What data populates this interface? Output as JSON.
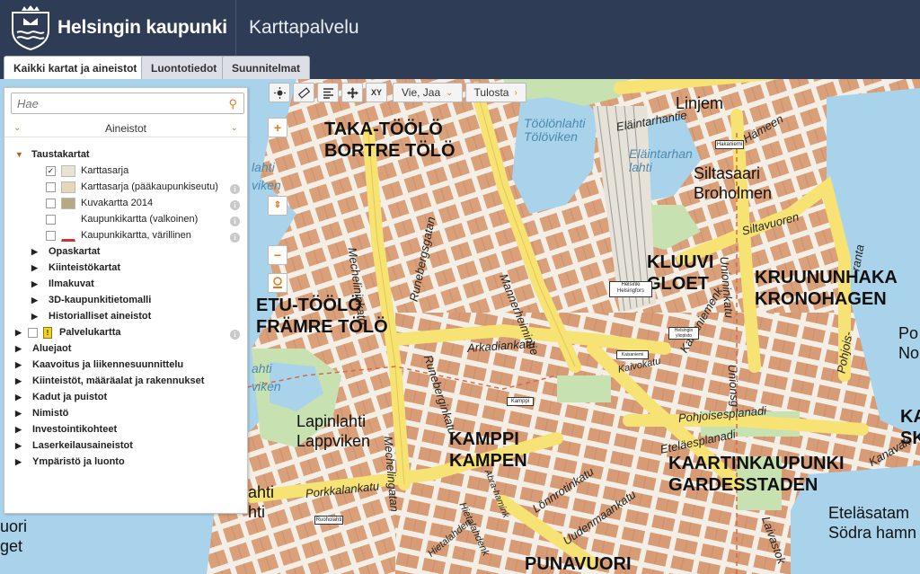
{
  "header": {
    "brand": "Helsingin kaupunki",
    "app_title": "Karttapalvelu",
    "bg_color": "#2f3c55"
  },
  "tabs": [
    {
      "label": "Kaikki kartat ja aineistot",
      "active": true
    },
    {
      "label": "Luontotiedot",
      "active": false
    },
    {
      "label": "Suunnitelmat",
      "active": false
    }
  ],
  "toolbar": {
    "icons": [
      "brightness-icon",
      "measure-icon",
      "legend-icon",
      "move-icon",
      "xy-coordinates-icon"
    ],
    "xy_label": "XY",
    "share_label": "Vie, Jaa",
    "print_label": "Tulosta"
  },
  "zoom": {
    "plus": "+",
    "minus": "−"
  },
  "panel": {
    "search_placeholder": "Hae",
    "accordion_title": "Aineistot",
    "tree": {
      "taustakartat": "Taustakartat",
      "layers": [
        {
          "label": "Karttasarja",
          "checked": true,
          "info": false
        },
        {
          "label": "Karttasarja (pääkaupunkiseutu)",
          "checked": false,
          "info": true
        },
        {
          "label": "Kuvakartta 2014",
          "checked": false,
          "info": true
        },
        {
          "label": "Kaupunkikartta (valkoinen)",
          "checked": false,
          "info": true
        },
        {
          "label": "Kaupunkikartta, värillinen",
          "checked": false,
          "info": true
        }
      ],
      "sub_groups": [
        "Opaskartat",
        "Kiinteistökartat",
        "Ilmakuvat",
        "3D-kaupunkitietomalli",
        "Historialliset aineistot"
      ],
      "palvelukartta": "Palvelukartta",
      "top_groups": [
        "Aluejaot",
        "Kaavoitus ja liikennesuunnittelu",
        "Kiinteistöt, määräalat ja rakennukset",
        "Kadut ja puistot",
        "Nimistö",
        "Investointikohteet",
        "Laserkeilausaineistot",
        "Ympäristö ja luonto"
      ]
    }
  },
  "map": {
    "districts": {
      "taka_toolo": [
        "TAKA-TÖÖLÖ",
        "BORTRE TÖLÖ"
      ],
      "etu_toolo": [
        "ETU-TÖÖLÖ",
        "FRÄMRE TÖLÖ"
      ],
      "kluuvi": [
        "KLUUVI",
        "GLOET"
      ],
      "kruununhaka": [
        "KRUUNUNHAKA",
        "KRONOHAGEN"
      ],
      "kamppi": [
        "KAMPPI",
        "KAMPEN"
      ],
      "kaartinkaupunki": [
        "KAARTINKAUPUNKI",
        "GARDESSTADEN"
      ],
      "punavuori": "PUNAVUORI"
    },
    "places": {
      "lapinlahti": [
        "Lapinlahti",
        "Lappviken"
      ],
      "siltasaari": [
        "Siltasaari",
        "Broholmen"
      ],
      "etelasatama": [
        "Eteläsatam",
        "Södra hamn"
      ],
      "linjat": "Linjem",
      "po": [
        "Po",
        "No"
      ],
      "ka": [
        "KA",
        "SK"
      ],
      "uori": [
        "uori",
        "get"
      ],
      "ahti": [
        "ahti",
        "hti"
      ]
    },
    "water": {
      "toolonlahti": [
        "Töölönlahti",
        "Tölöviken"
      ],
      "elaintarhanlahti": [
        "Eläintarhan",
        "lahti"
      ],
      "lahti": [
        "lahti",
        "viken"
      ],
      "lahti2": [
        "ahti",
        "viken"
      ]
    },
    "streets": {
      "mechelininkatu": "Mechelininkatu",
      "mechelingatan": "Mechelingatan",
      "runebergsgatan": "Runebergsgatan",
      "runeberginkatu": "Runeberginkatu",
      "mannerheimintie": "Mannerheimintie",
      "arkadiankatu": "Arkadiankatu",
      "kaivokatu": "Kaivokatu",
      "pohjoisesplanadi": "Pohjoisesplanadi",
      "etelaesplanadi": "Eteläesplanadi",
      "lonnrotinkatu": "Lönnrotinkatu",
      "uudenmaankatu": "Uudenmaankatu",
      "porkkalankatu": "Porkkalankatu",
      "unioninkatu": "Unioninkatu",
      "unionsg": "Unionsg",
      "kaisaniemenkatu": "Kaisaniemenk",
      "siltavuoren": "Siltavuoren",
      "hameen": "Hämeen",
      "elaintarhantie": "Eläintarhantie",
      "pohjois": "Pohjois-",
      "ranta": "ranta",
      "laivastokatu": "Laivastok",
      "kanavakatu": "Kanavak",
      "abrahamink": "Abra-hamink",
      "hietalahdenk": "Hietalahdenk",
      "hietalahdentori": "Hietalahden",
      "ranta2": "ranta"
    },
    "signs": [
      "Helsinki Helsingfors",
      "Hakaniemi",
      "Kaisaniemi",
      "Helsingin yliopisto",
      "Kamppi",
      "Ruoholahti"
    ]
  },
  "colors": {
    "accent": "#e07a16",
    "water": "#a9d3ea",
    "buildings": "#d89b73",
    "major_road": "#f6e373",
    "park": "#c7e2b0"
  }
}
